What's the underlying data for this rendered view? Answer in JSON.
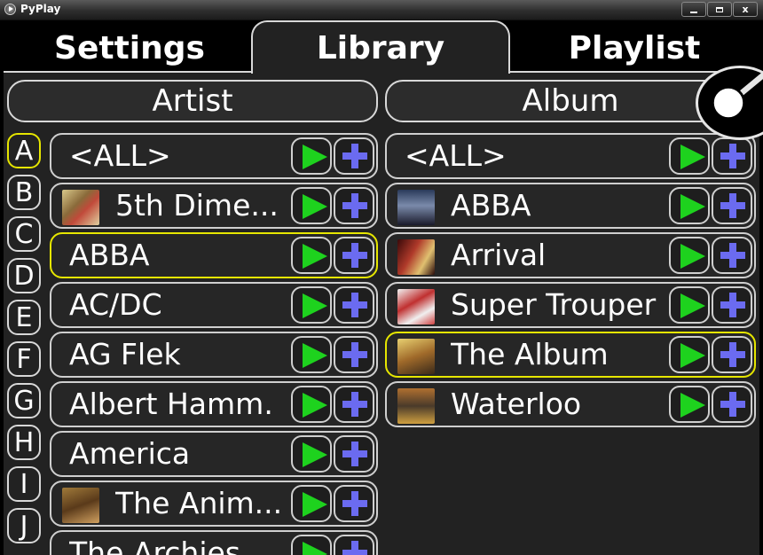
{
  "window": {
    "title": "PyPlay",
    "minimize_glyph": "minimize-icon",
    "maximize_glyph": "maximize-icon",
    "close_label": "x"
  },
  "tabs": [
    {
      "label": "Settings",
      "active": false
    },
    {
      "label": "Library",
      "active": true
    },
    {
      "label": "Playlist",
      "active": false
    }
  ],
  "artist_column": {
    "header": "Artist",
    "letters": [
      "A",
      "B",
      "C",
      "D",
      "E",
      "F",
      "G",
      "H",
      "I",
      "J"
    ],
    "active_letter": "A",
    "rows": [
      {
        "label": "<ALL>",
        "thumb": null,
        "selected": false
      },
      {
        "label": "5th Dime...",
        "thumb": "album-art",
        "selected": false
      },
      {
        "label": "ABBA",
        "thumb": null,
        "selected": true
      },
      {
        "label": "AC/DC",
        "thumb": null,
        "selected": false
      },
      {
        "label": "AG Flek",
        "thumb": null,
        "selected": false
      },
      {
        "label": "Albert Hamm...",
        "thumb": null,
        "selected": false
      },
      {
        "label": "America",
        "thumb": null,
        "selected": false
      },
      {
        "label": "The Anim...",
        "thumb": "album-art",
        "selected": false
      },
      {
        "label": "The Archies",
        "thumb": null,
        "selected": false
      }
    ]
  },
  "album_column": {
    "header": "Album",
    "rows": [
      {
        "label": "<ALL>",
        "thumb": null,
        "selected": false
      },
      {
        "label": "ABBA",
        "thumb": "album-art",
        "selected": false
      },
      {
        "label": "Arrival",
        "thumb": "album-art",
        "selected": false
      },
      {
        "label": "Super Trouper",
        "thumb": "album-art",
        "selected": false
      },
      {
        "label": "The Album",
        "thumb": "album-art",
        "selected": true
      },
      {
        "label": "Waterloo",
        "thumb": "album-art",
        "selected": false
      }
    ]
  },
  "icons": {
    "play": "play-icon",
    "add": "add-icon",
    "search": "search-icon"
  },
  "colors": {
    "play_green": "#1ed21e",
    "add_blue": "#6b6bf0",
    "selection_yellow": "#e6e600",
    "panel_bg": "#222222"
  }
}
